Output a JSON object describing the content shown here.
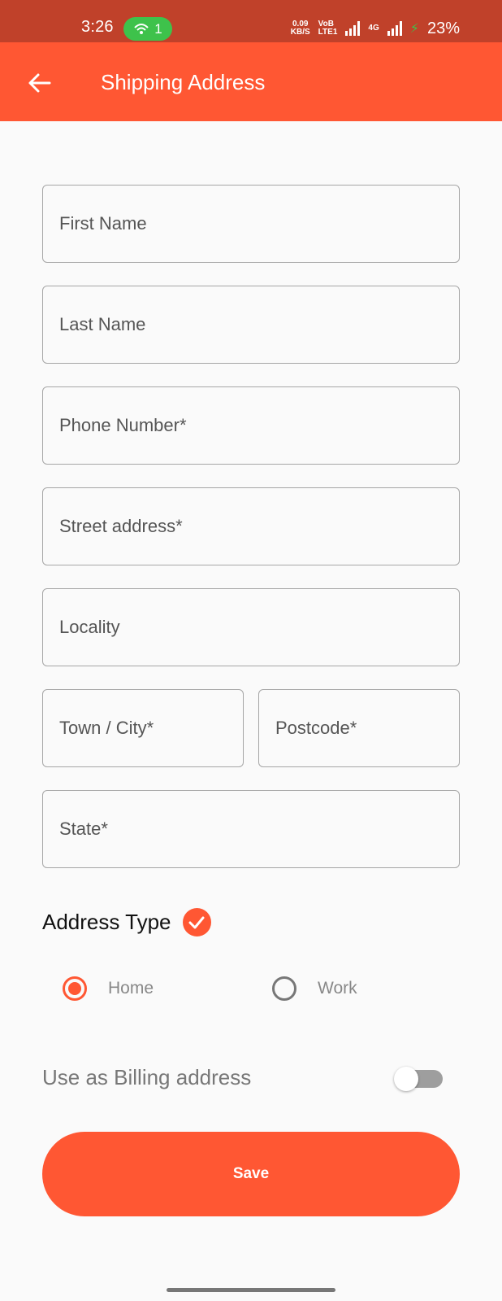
{
  "status_bar": {
    "time": "3:26",
    "hotspot_count": "1",
    "net_speed_value": "0.09",
    "net_speed_unit": "KB/S",
    "volte_top": "VoB",
    "volte_bottom": "LTE1",
    "network_type": "4G",
    "battery": "23%"
  },
  "app_bar": {
    "title": "Shipping Address",
    "back_icon": "arrow-left-icon"
  },
  "form": {
    "first_name": {
      "value": "",
      "placeholder": "First Name"
    },
    "last_name": {
      "value": "",
      "placeholder": "Last Name"
    },
    "phone": {
      "value": "",
      "placeholder": "Phone Number*"
    },
    "street": {
      "value": "",
      "placeholder": "Street address*"
    },
    "locality": {
      "value": "",
      "placeholder": "Locality"
    },
    "town": {
      "value": "",
      "placeholder": "Town / City*"
    },
    "postcode": {
      "value": "",
      "placeholder": "Postcode*"
    },
    "state": {
      "value": "",
      "placeholder": "State*"
    }
  },
  "address_type": {
    "label": "Address Type",
    "check_icon": "check-circle-icon",
    "options": [
      {
        "label": "Home",
        "selected": true
      },
      {
        "label": "Work",
        "selected": false
      }
    ]
  },
  "billing": {
    "label": "Use as Billing address",
    "enabled": false
  },
  "save_label": "Save",
  "colors": {
    "accent": "#ff5733",
    "status_bar": "#c0412a",
    "hotspot_pill": "#3ec24b"
  }
}
